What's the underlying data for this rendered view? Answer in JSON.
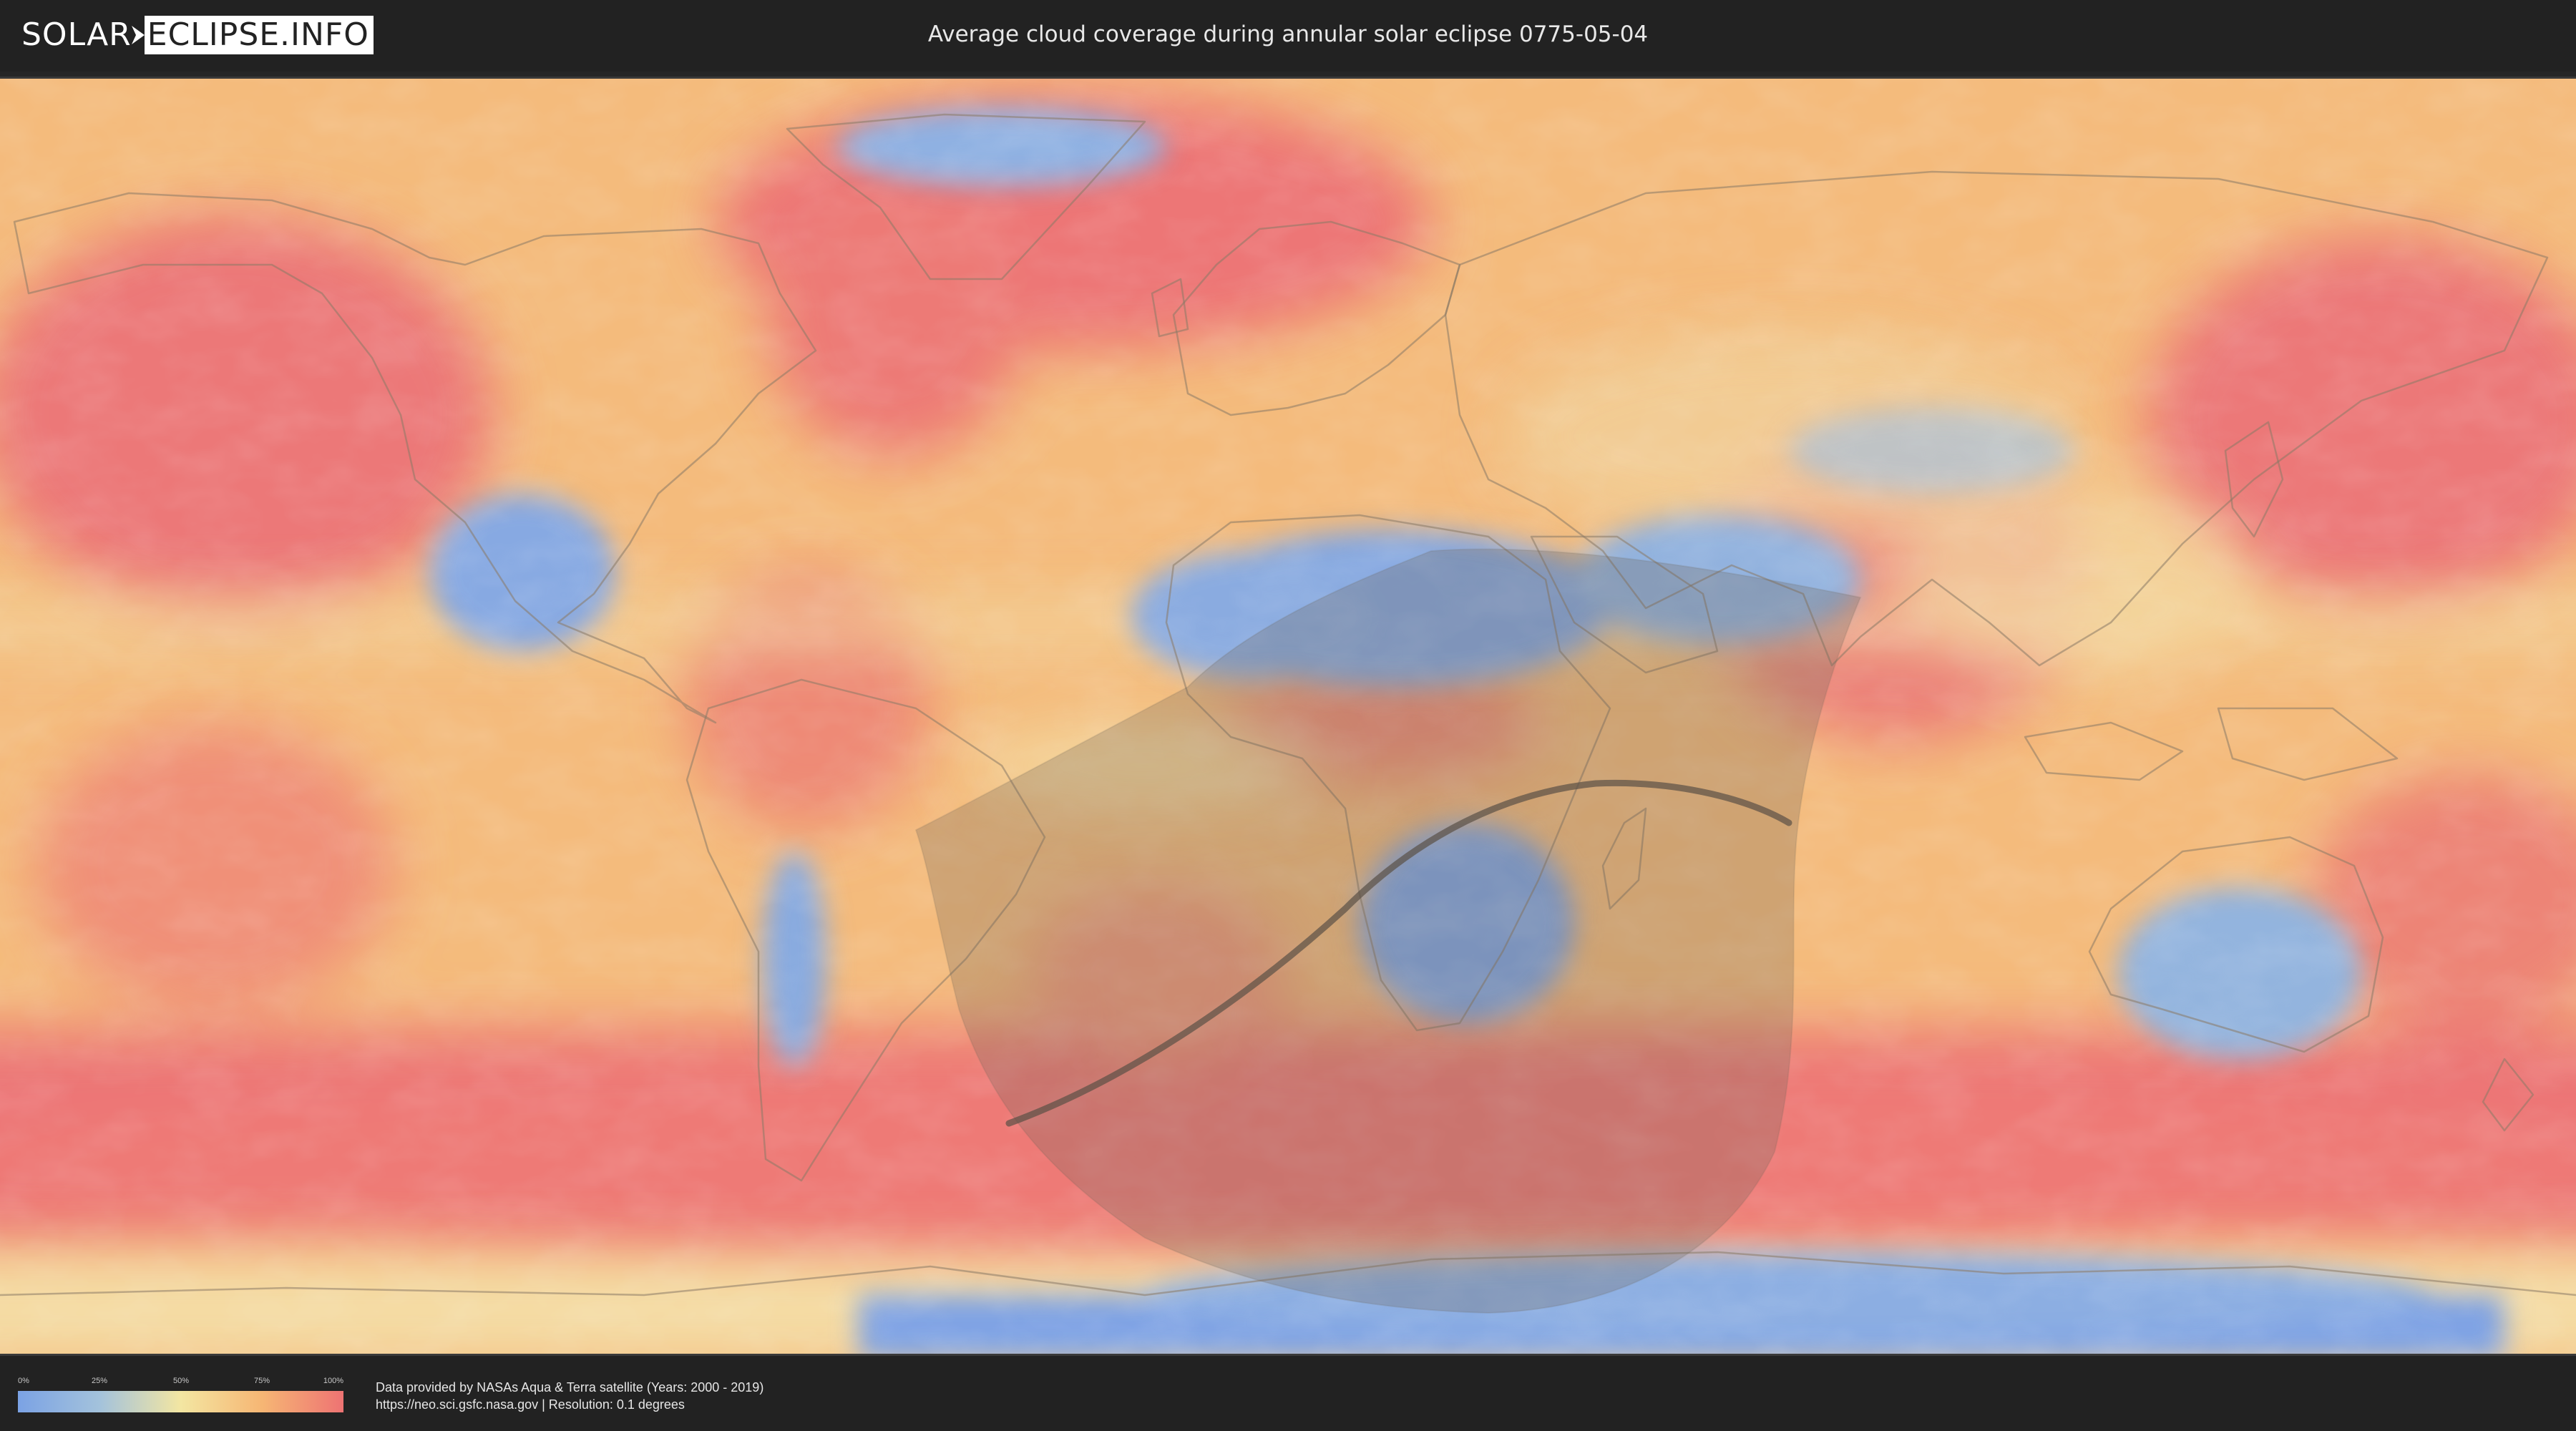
{
  "header": {
    "logo_left": "SOLAR",
    "logo_right": "ECLIPSE.INFO",
    "title": "Average cloud coverage during annular solar eclipse 0775-05-04"
  },
  "map": {
    "icon": "world-map-icon",
    "colors": {
      "clear": "#7ba2e4",
      "low": "#a3c2dc",
      "mid": "#f3e6a2",
      "high": "#f6b674",
      "overcast": "#ee7373",
      "eclipse_zone": "#6e665a",
      "central_line": "#5a5046",
      "coastline": "#8a7a66"
    }
  },
  "legend": {
    "ticks": [
      "0%",
      "25%",
      "50%",
      "75%",
      "100%"
    ]
  },
  "footer": {
    "line1": "Data provided by NASAs Aqua & Terra satellite (Years: 2000 - 2019)",
    "line2": "https://neo.sci.gsfc.nasa.gov | Resolution: 0.1 degrees"
  }
}
